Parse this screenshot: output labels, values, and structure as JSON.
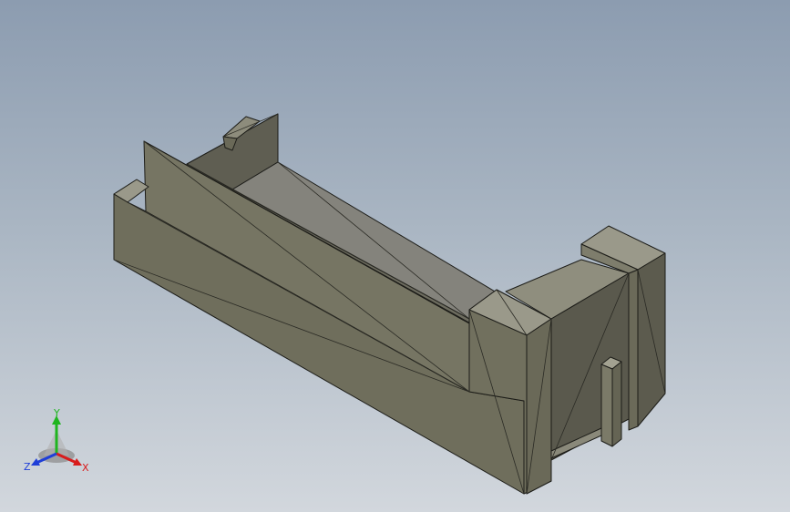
{
  "viewport": {
    "background_top": "#8c9cb0",
    "background_bottom": "#d2d7dd"
  },
  "model": {
    "face_color": "#7b7a68",
    "edge_color": "#1c1c18"
  },
  "triad": {
    "y_label": "Y",
    "x_label": "X",
    "z_label": "Z",
    "y_color": "#1fb51f",
    "x_color": "#d81c1c",
    "z_color": "#1f3fd8"
  }
}
